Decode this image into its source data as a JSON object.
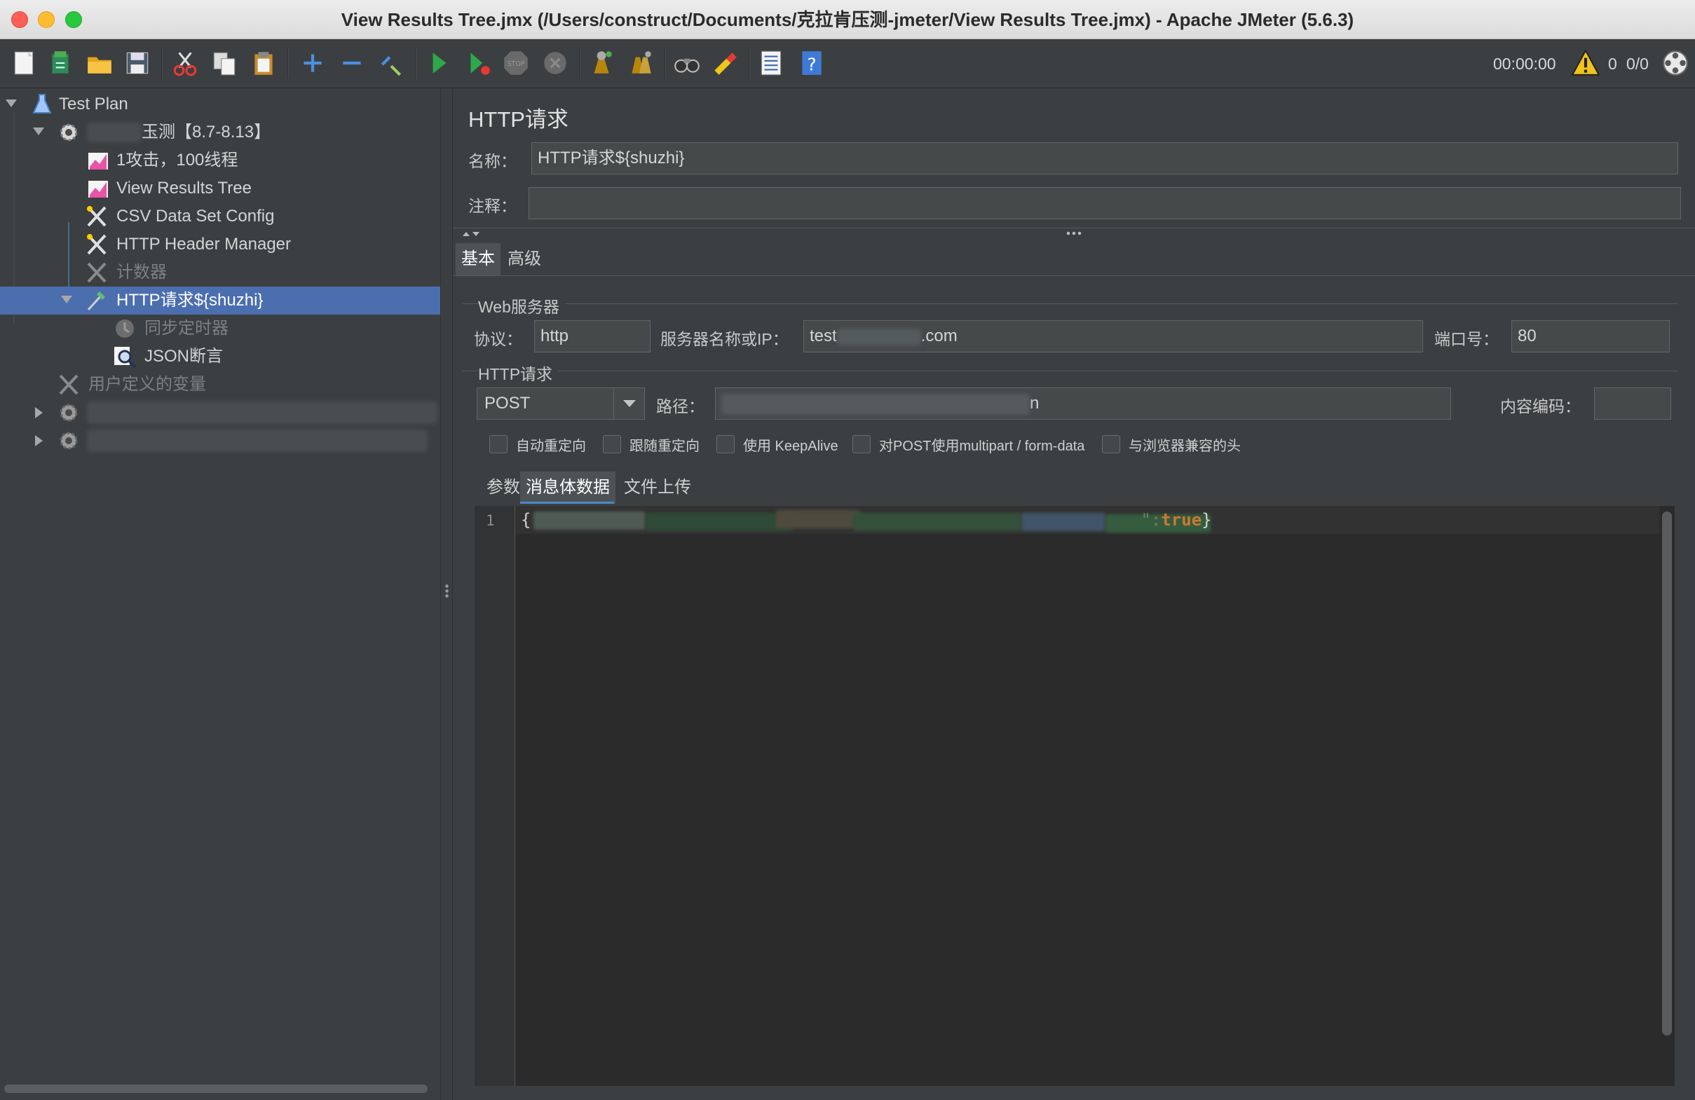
{
  "window": {
    "title": "View Results Tree.jmx (/Users/construct/Documents/克拉肯压测-jmeter/View Results Tree.jmx) - Apache JMeter (5.6.3)"
  },
  "toolbar": {
    "icons": [
      "new-icon",
      "templates-icon",
      "open-icon",
      "save-icon",
      "cut-icon",
      "copy-icon",
      "paste-icon",
      "expand-icon",
      "collapse-icon",
      "toggle-icon",
      "start-icon",
      "start-no-pauses-icon",
      "stop-icon",
      "shutdown-icon",
      "clear-icon",
      "clear-all-icon",
      "search-icon",
      "reset-search-icon",
      "function-helper-icon",
      "help-icon"
    ],
    "timer": "00:00:00",
    "warning_count": "0",
    "threads": "0/0"
  },
  "tree": {
    "items": [
      {
        "label": "Test Plan",
        "icon": "test-plan-icon"
      },
      {
        "label": "玉测【8.7-8.13】",
        "icon": "thread-group-icon"
      },
      {
        "label": "1攻击，100线程",
        "icon": "listener-icon"
      },
      {
        "label": "View Results Tree",
        "icon": "listener-icon"
      },
      {
        "label": "CSV Data Set Config",
        "icon": "config-icon"
      },
      {
        "label": "HTTP Header Manager",
        "icon": "config-icon"
      },
      {
        "label": "计数器",
        "icon": "config-icon"
      },
      {
        "label": "HTTP请求${shuzhi}",
        "icon": "sampler-icon"
      },
      {
        "label": "同步定时器",
        "icon": "timer-icon"
      },
      {
        "label": "JSON断言",
        "icon": "assertion-icon"
      },
      {
        "label": "用户定义的变量",
        "icon": "config-icon"
      },
      {
        "label": "",
        "icon": "thread-group-icon"
      },
      {
        "label": "",
        "icon": "thread-group-icon"
      }
    ]
  },
  "panel": {
    "title": "HTTP请求",
    "name_label": "名称：",
    "name_value": "HTTP请求${shuzhi}",
    "comment_label": "注释：",
    "comment_value": "",
    "tabs": [
      {
        "label": "基本"
      },
      {
        "label": "高级"
      }
    ],
    "web_server": {
      "group_title": "Web服务器",
      "protocol_label": "协议：",
      "protocol_value": "http",
      "server_label": "服务器名称或IP：",
      "server_prefix": "test",
      "server_suffix": ".com",
      "port_label": "端口号：",
      "port_value": "80"
    },
    "http_request": {
      "group_title": "HTTP请求",
      "method": "POST",
      "path_label": "路径：",
      "path_suffix": "n",
      "encoding_label": "内容编码：",
      "encoding_value": ""
    },
    "checkboxes": [
      {
        "label": "自动重定向"
      },
      {
        "label": "跟随重定向"
      },
      {
        "label": "使用 KeepAlive"
      },
      {
        "label": "对POST使用multipart / form-data"
      },
      {
        "label": "与浏览器兼容的头"
      }
    ],
    "body_tabs": [
      {
        "label": "参数"
      },
      {
        "label": "消息体数据"
      },
      {
        "label": "文件上传"
      }
    ],
    "editor": {
      "line_number": "1",
      "open_brace": "{",
      "tail_quote": "\":",
      "keyword": "true",
      "close_brace": "}"
    }
  },
  "colors": {
    "selection": "#4b6eaf",
    "background": "#3c3f41",
    "editor_bg": "#2b2b2b",
    "keyword": "#cc7832"
  }
}
